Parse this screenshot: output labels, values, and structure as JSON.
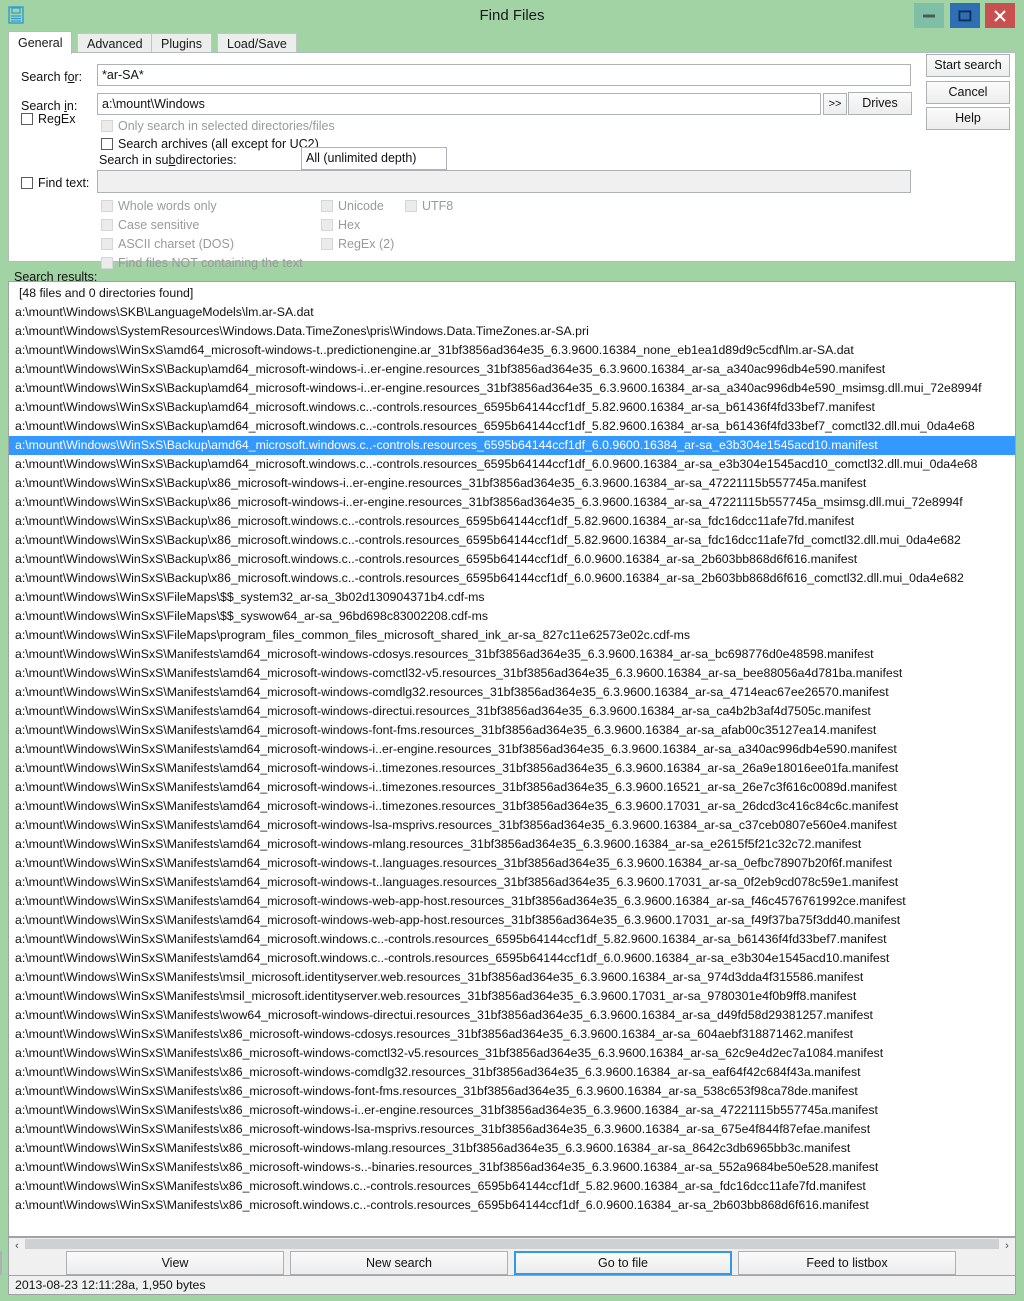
{
  "window": {
    "title": "Find Files",
    "icon": "floppy-disk-icon",
    "minimize_label": "–",
    "maximize_label": "□",
    "close_label": "×",
    "colors": {
      "frame": "#a1d3a5",
      "minimize_bg": "#7fbfa8",
      "maximize_bg": "#2f6fb5",
      "close_bg": "#c8504f",
      "selection": "#3399ff",
      "focus_border": "#3399e0"
    }
  },
  "tabs": [
    {
      "label": "General",
      "active": true
    },
    {
      "label": "Advanced",
      "active": false
    },
    {
      "label": "Plugins",
      "active": false
    },
    {
      "label": "Load/Save",
      "active": false
    }
  ],
  "general": {
    "search_for_label": "Search for:",
    "search_for_value": "*ar-SA*",
    "search_in_label": "Search in:",
    "search_in_value": "a:\\mount\\Windows",
    "expand_button": ">>",
    "drives_button": "Drives",
    "regex_label": "RegEx",
    "only_selected_label": "Only search in selected directories/files",
    "search_archives_label": "Search archives (all except for UC2)",
    "subdirs_label": "Search in subdirectories:",
    "subdirs_value": "All (unlimited depth)",
    "find_text_label": "Find text:",
    "find_text_value": "",
    "text_options": [
      "Whole words only",
      "Case sensitive",
      "ASCII charset (DOS)",
      "Find files NOT containing the text"
    ],
    "encoding_options": [
      "Unicode",
      "Hex",
      "RegEx (2)"
    ],
    "utf8_option": "UTF8"
  },
  "action_buttons": {
    "start_search": "Start search",
    "cancel": "Cancel",
    "help": "Help"
  },
  "results": {
    "label": "Search results:",
    "summary": "[48 files and 0 directories found]",
    "selected_index": 7,
    "items": [
      "a:\\mount\\Windows\\SKB\\LanguageModels\\lm.ar-SA.dat",
      "a:\\mount\\Windows\\SystemResources\\Windows.Data.TimeZones\\pris\\Windows.Data.TimeZones.ar-SA.pri",
      "a:\\mount\\Windows\\WinSxS\\amd64_microsoft-windows-t..predictionengine.ar_31bf3856ad364e35_6.3.9600.16384_none_eb1ea1d89d9c5cdf\\lm.ar-SA.dat",
      "a:\\mount\\Windows\\WinSxS\\Backup\\amd64_microsoft-windows-i..er-engine.resources_31bf3856ad364e35_6.3.9600.16384_ar-sa_a340ac996db4e590.manifest",
      "a:\\mount\\Windows\\WinSxS\\Backup\\amd64_microsoft-windows-i..er-engine.resources_31bf3856ad364e35_6.3.9600.16384_ar-sa_a340ac996db4e590_msimsg.dll.mui_72e8994f",
      "a:\\mount\\Windows\\WinSxS\\Backup\\amd64_microsoft.windows.c..-controls.resources_6595b64144ccf1df_5.82.9600.16384_ar-sa_b61436f4fd33bef7.manifest",
      "a:\\mount\\Windows\\WinSxS\\Backup\\amd64_microsoft.windows.c..-controls.resources_6595b64144ccf1df_5.82.9600.16384_ar-sa_b61436f4fd33bef7_comctl32.dll.mui_0da4e68",
      "a:\\mount\\Windows\\WinSxS\\Backup\\amd64_microsoft.windows.c..-controls.resources_6595b64144ccf1df_6.0.9600.16384_ar-sa_e3b304e1545acd10.manifest",
      "a:\\mount\\Windows\\WinSxS\\Backup\\amd64_microsoft.windows.c..-controls.resources_6595b64144ccf1df_6.0.9600.16384_ar-sa_e3b304e1545acd10_comctl32.dll.mui_0da4e68",
      "a:\\mount\\Windows\\WinSxS\\Backup\\x86_microsoft-windows-i..er-engine.resources_31bf3856ad364e35_6.3.9600.16384_ar-sa_47221115b557745a.manifest",
      "a:\\mount\\Windows\\WinSxS\\Backup\\x86_microsoft-windows-i..er-engine.resources_31bf3856ad364e35_6.3.9600.16384_ar-sa_47221115b557745a_msimsg.dll.mui_72e8994f",
      "a:\\mount\\Windows\\WinSxS\\Backup\\x86_microsoft.windows.c..-controls.resources_6595b64144ccf1df_5.82.9600.16384_ar-sa_fdc16dcc11afe7fd.manifest",
      "a:\\mount\\Windows\\WinSxS\\Backup\\x86_microsoft.windows.c..-controls.resources_6595b64144ccf1df_5.82.9600.16384_ar-sa_fdc16dcc11afe7fd_comctl32.dll.mui_0da4e682",
      "a:\\mount\\Windows\\WinSxS\\Backup\\x86_microsoft.windows.c..-controls.resources_6595b64144ccf1df_6.0.9600.16384_ar-sa_2b603bb868d6f616.manifest",
      "a:\\mount\\Windows\\WinSxS\\Backup\\x86_microsoft.windows.c..-controls.resources_6595b64144ccf1df_6.0.9600.16384_ar-sa_2b603bb868d6f616_comctl32.dll.mui_0da4e682",
      "a:\\mount\\Windows\\WinSxS\\FileMaps\\$$_system32_ar-sa_3b02d130904371b4.cdf-ms",
      "a:\\mount\\Windows\\WinSxS\\FileMaps\\$$_syswow64_ar-sa_96bd698c83002208.cdf-ms",
      "a:\\mount\\Windows\\WinSxS\\FileMaps\\program_files_common_files_microsoft_shared_ink_ar-sa_827c11e62573e02c.cdf-ms",
      "a:\\mount\\Windows\\WinSxS\\Manifests\\amd64_microsoft-windows-cdosys.resources_31bf3856ad364e35_6.3.9600.16384_ar-sa_bc698776d0e48598.manifest",
      "a:\\mount\\Windows\\WinSxS\\Manifests\\amd64_microsoft-windows-comctl32-v5.resources_31bf3856ad364e35_6.3.9600.16384_ar-sa_bee88056a4d781ba.manifest",
      "a:\\mount\\Windows\\WinSxS\\Manifests\\amd64_microsoft-windows-comdlg32.resources_31bf3856ad364e35_6.3.9600.16384_ar-sa_4714eac67ee26570.manifest",
      "a:\\mount\\Windows\\WinSxS\\Manifests\\amd64_microsoft-windows-directui.resources_31bf3856ad364e35_6.3.9600.16384_ar-sa_ca4b2b3af4d7505c.manifest",
      "a:\\mount\\Windows\\WinSxS\\Manifests\\amd64_microsoft-windows-font-fms.resources_31bf3856ad364e35_6.3.9600.16384_ar-sa_afab00c35127ea14.manifest",
      "a:\\mount\\Windows\\WinSxS\\Manifests\\amd64_microsoft-windows-i..er-engine.resources_31bf3856ad364e35_6.3.9600.16384_ar-sa_a340ac996db4e590.manifest",
      "a:\\mount\\Windows\\WinSxS\\Manifests\\amd64_microsoft-windows-i..timezones.resources_31bf3856ad364e35_6.3.9600.16384_ar-sa_26a9e18016ee01fa.manifest",
      "a:\\mount\\Windows\\WinSxS\\Manifests\\amd64_microsoft-windows-i..timezones.resources_31bf3856ad364e35_6.3.9600.16521_ar-sa_26e7c3f616c0089d.manifest",
      "a:\\mount\\Windows\\WinSxS\\Manifests\\amd64_microsoft-windows-i..timezones.resources_31bf3856ad364e35_6.3.9600.17031_ar-sa_26dcd3c416c84c6c.manifest",
      "a:\\mount\\Windows\\WinSxS\\Manifests\\amd64_microsoft-windows-lsa-msprivs.resources_31bf3856ad364e35_6.3.9600.16384_ar-sa_c37ceb0807e560e4.manifest",
      "a:\\mount\\Windows\\WinSxS\\Manifests\\amd64_microsoft-windows-mlang.resources_31bf3856ad364e35_6.3.9600.16384_ar-sa_e2615f5f21c32c72.manifest",
      "a:\\mount\\Windows\\WinSxS\\Manifests\\amd64_microsoft-windows-t..languages.resources_31bf3856ad364e35_6.3.9600.16384_ar-sa_0efbc78907b20f6f.manifest",
      "a:\\mount\\Windows\\WinSxS\\Manifests\\amd64_microsoft-windows-t..languages.resources_31bf3856ad364e35_6.3.9600.17031_ar-sa_0f2eb9cd078c59e1.manifest",
      "a:\\mount\\Windows\\WinSxS\\Manifests\\amd64_microsoft-windows-web-app-host.resources_31bf3856ad364e35_6.3.9600.16384_ar-sa_f46c4576761992ce.manifest",
      "a:\\mount\\Windows\\WinSxS\\Manifests\\amd64_microsoft-windows-web-app-host.resources_31bf3856ad364e35_6.3.9600.17031_ar-sa_f49f37ba75f3dd40.manifest",
      "a:\\mount\\Windows\\WinSxS\\Manifests\\amd64_microsoft.windows.c..-controls.resources_6595b64144ccf1df_5.82.9600.16384_ar-sa_b61436f4fd33bef7.manifest",
      "a:\\mount\\Windows\\WinSxS\\Manifests\\amd64_microsoft.windows.c..-controls.resources_6595b64144ccf1df_6.0.9600.16384_ar-sa_e3b304e1545acd10.manifest",
      "a:\\mount\\Windows\\WinSxS\\Manifests\\msil_microsoft.identityserver.web.resources_31bf3856ad364e35_6.3.9600.16384_ar-sa_974d3dda4f315586.manifest",
      "a:\\mount\\Windows\\WinSxS\\Manifests\\msil_microsoft.identityserver.web.resources_31bf3856ad364e35_6.3.9600.17031_ar-sa_9780301e4f0b9ff8.manifest",
      "a:\\mount\\Windows\\WinSxS\\Manifests\\wow64_microsoft-windows-directui.resources_31bf3856ad364e35_6.3.9600.16384_ar-sa_d49fd58d29381257.manifest",
      "a:\\mount\\Windows\\WinSxS\\Manifests\\x86_microsoft-windows-cdosys.resources_31bf3856ad364e35_6.3.9600.16384_ar-sa_604aebf318871462.manifest",
      "a:\\mount\\Windows\\WinSxS\\Manifests\\x86_microsoft-windows-comctl32-v5.resources_31bf3856ad364e35_6.3.9600.16384_ar-sa_62c9e4d2ec7a1084.manifest",
      "a:\\mount\\Windows\\WinSxS\\Manifests\\x86_microsoft-windows-comdlg32.resources_31bf3856ad364e35_6.3.9600.16384_ar-sa_eaf64f42c684f43a.manifest",
      "a:\\mount\\Windows\\WinSxS\\Manifests\\x86_microsoft-windows-font-fms.resources_31bf3856ad364e35_6.3.9600.16384_ar-sa_538c653f98ca78de.manifest",
      "a:\\mount\\Windows\\WinSxS\\Manifests\\x86_microsoft-windows-i..er-engine.resources_31bf3856ad364e35_6.3.9600.16384_ar-sa_47221115b557745a.manifest",
      "a:\\mount\\Windows\\WinSxS\\Manifests\\x86_microsoft-windows-lsa-msprivs.resources_31bf3856ad364e35_6.3.9600.16384_ar-sa_675e4f844f87efae.manifest",
      "a:\\mount\\Windows\\WinSxS\\Manifests\\x86_microsoft-windows-mlang.resources_31bf3856ad364e35_6.3.9600.16384_ar-sa_8642c3db6965bb3c.manifest",
      "a:\\mount\\Windows\\WinSxS\\Manifests\\x86_microsoft-windows-s..-binaries.resources_31bf3856ad364e35_6.3.9600.16384_ar-sa_552a9684be50e528.manifest",
      "a:\\mount\\Windows\\WinSxS\\Manifests\\x86_microsoft.windows.c..-controls.resources_6595b64144ccf1df_5.82.9600.16384_ar-sa_fdc16dcc11afe7fd.manifest",
      "a:\\mount\\Windows\\WinSxS\\Manifests\\x86_microsoft.windows.c..-controls.resources_6595b64144ccf1df_6.0.9600.16384_ar-sa_2b603bb868d6f616.manifest"
    ]
  },
  "bottom_buttons": [
    {
      "label": "View",
      "focused": false
    },
    {
      "label": "New search",
      "focused": false
    },
    {
      "label": "Go to file",
      "focused": true
    },
    {
      "label": "Feed to listbox",
      "focused": false
    }
  ],
  "statusbar": {
    "text": "2013-08-23 12:11:28a, 1,950 bytes"
  },
  "scrollbar": {
    "left_arrow": "‹",
    "right_arrow": "›"
  }
}
